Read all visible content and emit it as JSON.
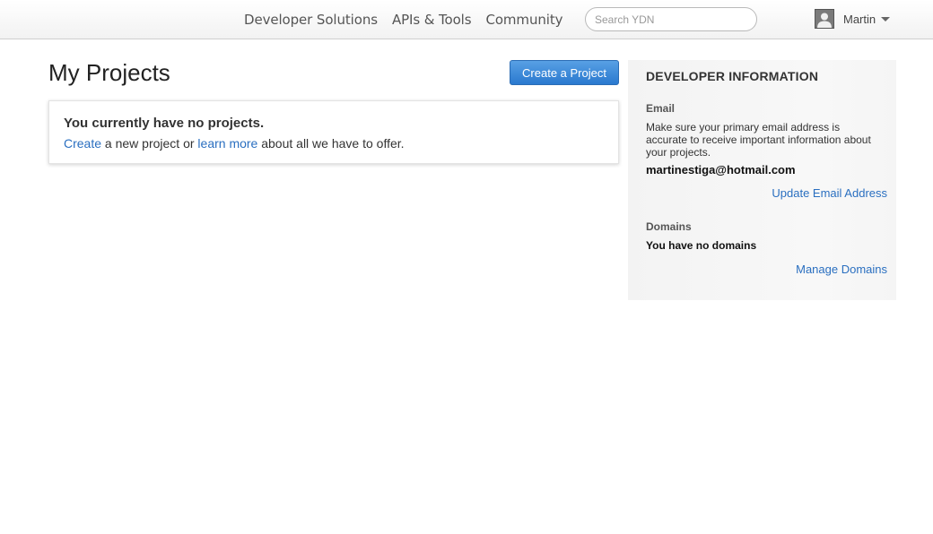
{
  "header": {
    "nav": [
      "Developer Solutions",
      "APIs & Tools",
      "Community"
    ],
    "search_placeholder": "Search YDN",
    "username": "Martin"
  },
  "main": {
    "title": "My Projects",
    "create_button": "Create a Project",
    "empty_title": "You currently have no projects.",
    "empty_link_create": "Create",
    "empty_text_1": " a new project or ",
    "empty_link_learn": "learn more",
    "empty_text_2": " about all we have to offer."
  },
  "sidebar": {
    "heading": "DEVELOPER INFORMATION",
    "email_label": "Email",
    "email_desc": "Make sure your primary email address is accurate to receive important information about your projects.",
    "email_value": "martinestiga@hotmail.com",
    "update_email_link": "Update Email Address",
    "domains_label": "Domains",
    "domains_value": "You have no domains",
    "manage_domains_link": "Manage Domains"
  },
  "colors": {
    "link": "#2a6fc0",
    "button_blue": "#2a79cf"
  },
  "icons": [
    "user-avatar-icon",
    "chevron-down-icon"
  ]
}
